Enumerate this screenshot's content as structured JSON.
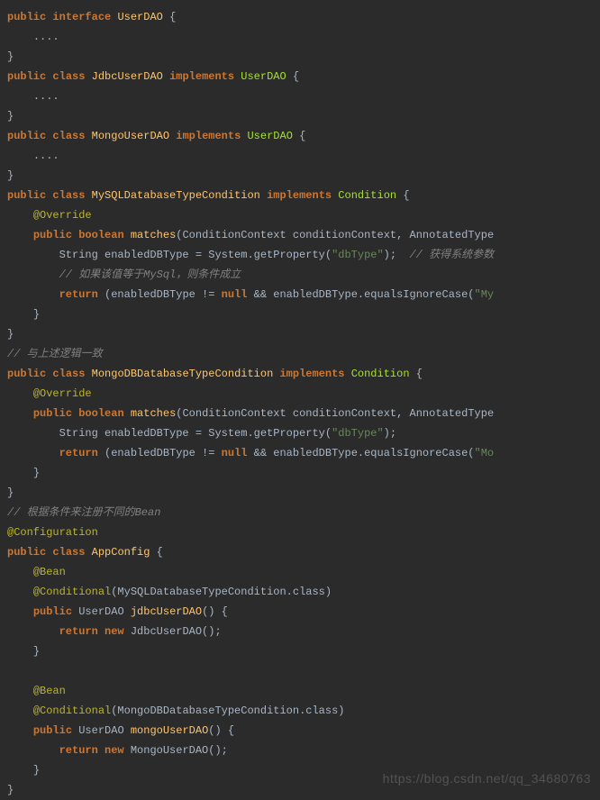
{
  "code": {
    "l1": {
      "kw1": "public",
      "kw2": "interface",
      "name": "UserDAO",
      "brace": "{"
    },
    "l2": {
      "dots": "...."
    },
    "l3": {
      "brace": "}"
    },
    "l4": {
      "kw1": "public",
      "kw2": "class",
      "name": "JdbcUserDAO",
      "kw3": "implements",
      "iface": "UserDAO",
      "brace": "{"
    },
    "l5": {
      "dots": "...."
    },
    "l6": {
      "brace": "}"
    },
    "l7": {
      "kw1": "public",
      "kw2": "class",
      "name": "MongoUserDAO",
      "kw3": "implements",
      "iface": "UserDAO",
      "brace": "{"
    },
    "l8": {
      "dots": "...."
    },
    "l9": {
      "brace": "}"
    },
    "l10": {
      "kw1": "public",
      "kw2": "class",
      "name": "MySQLDatabaseTypeCondition",
      "kw3": "implements",
      "iface": "Condition",
      "brace": "{"
    },
    "l11": {
      "ann": "@Override"
    },
    "l12": {
      "kw1": "public",
      "kw2": "boolean",
      "name": "matches",
      "p1": "(ConditionContext conditionContext, AnnotatedType"
    },
    "l13": {
      "pre": "String enabledDBType = System.getProperty(",
      "str": "\"dbType\"",
      "post": ");",
      "cmt": "// 获得系统参数"
    },
    "l14": {
      "cmt": "// 如果该值等于MySql，则条件成立"
    },
    "l15": {
      "kw": "return",
      "pre": "(enabledDBType != ",
      "nul": "null",
      "post": " && enabledDBType.equalsIgnoreCase(",
      "str": "\"My"
    },
    "l16": {
      "brace": "}"
    },
    "l17": {
      "brace": "}"
    },
    "l18": {
      "cmt": "// 与上述逻辑一致"
    },
    "l19": {
      "kw1": "public",
      "kw2": "class",
      "name": "MongoDBDatabaseTypeCondition",
      "kw3": "implements",
      "iface": "Condition",
      "brace": "{"
    },
    "l20": {
      "ann": "@Override"
    },
    "l21": {
      "kw1": "public",
      "kw2": "boolean",
      "name": "matches",
      "p1": "(ConditionContext conditionContext, AnnotatedType"
    },
    "l22": {
      "pre": "String enabledDBType = System.getProperty(",
      "str": "\"dbType\"",
      "post": ");"
    },
    "l23": {
      "kw": "return",
      "pre": "(enabledDBType != ",
      "nul": "null",
      "post": " && enabledDBType.equalsIgnoreCase(",
      "str": "\"Mo"
    },
    "l24": {
      "brace": "}"
    },
    "l25": {
      "brace": "}"
    },
    "l26": {
      "cmt": "// 根据条件来注册不同的Bean"
    },
    "l27": {
      "ann": "@Configuration"
    },
    "l28": {
      "kw1": "public",
      "kw2": "class",
      "name": "AppConfig",
      "brace": "{"
    },
    "l29": {
      "ann": "@Bean"
    },
    "l30": {
      "ann": "@Conditional",
      "args": "(MySQLDatabaseTypeCondition.class)"
    },
    "l31": {
      "kw1": "public",
      "ret": "UserDAO",
      "name": "jdbcUserDAO",
      "paren": "() {"
    },
    "l32": {
      "kw1": "return",
      "kw2": "new",
      "call": "JdbcUserDAO();"
    },
    "l33": {
      "brace": "}"
    },
    "l34": {
      "empty": " "
    },
    "l35": {
      "ann": "@Bean"
    },
    "l36": {
      "ann": "@Conditional",
      "args": "(MongoDBDatabaseTypeCondition.class)"
    },
    "l37": {
      "kw1": "public",
      "ret": "UserDAO",
      "name": "mongoUserDAO",
      "paren": "() {"
    },
    "l38": {
      "kw1": "return",
      "kw2": "new",
      "call": "MongoUserDAO();"
    },
    "l39": {
      "brace": "}"
    },
    "l40": {
      "brace": "}"
    }
  },
  "watermark": "https://blog.csdn.net/qq_34680763"
}
